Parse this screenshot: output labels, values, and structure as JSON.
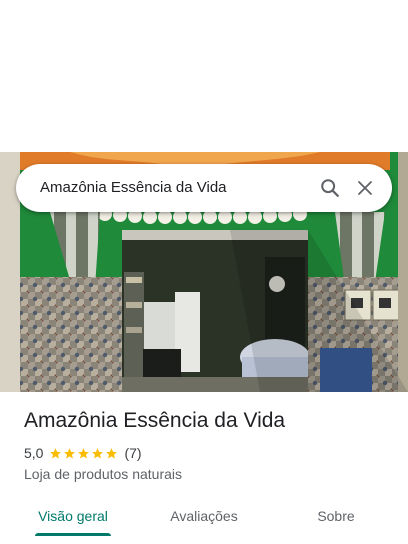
{
  "search": {
    "query": "Amazônia Essência da Vida",
    "search_icon": "search-icon",
    "close_icon": "close-icon"
  },
  "place": {
    "name": "Amazônia Essência da Vida",
    "rating": "5,0",
    "rating_value": 5,
    "star_count": 5,
    "review_count": "(7)",
    "category": "Loja de produtos naturais"
  },
  "tabs": [
    {
      "label": "Visão geral",
      "active": true
    },
    {
      "label": "Avaliações",
      "active": false
    },
    {
      "label": "Sobre",
      "active": false
    }
  ],
  "colors": {
    "accent": "#00796b",
    "star": "#fbbc04",
    "text_primary": "#202124",
    "text_secondary": "#5f6368"
  }
}
